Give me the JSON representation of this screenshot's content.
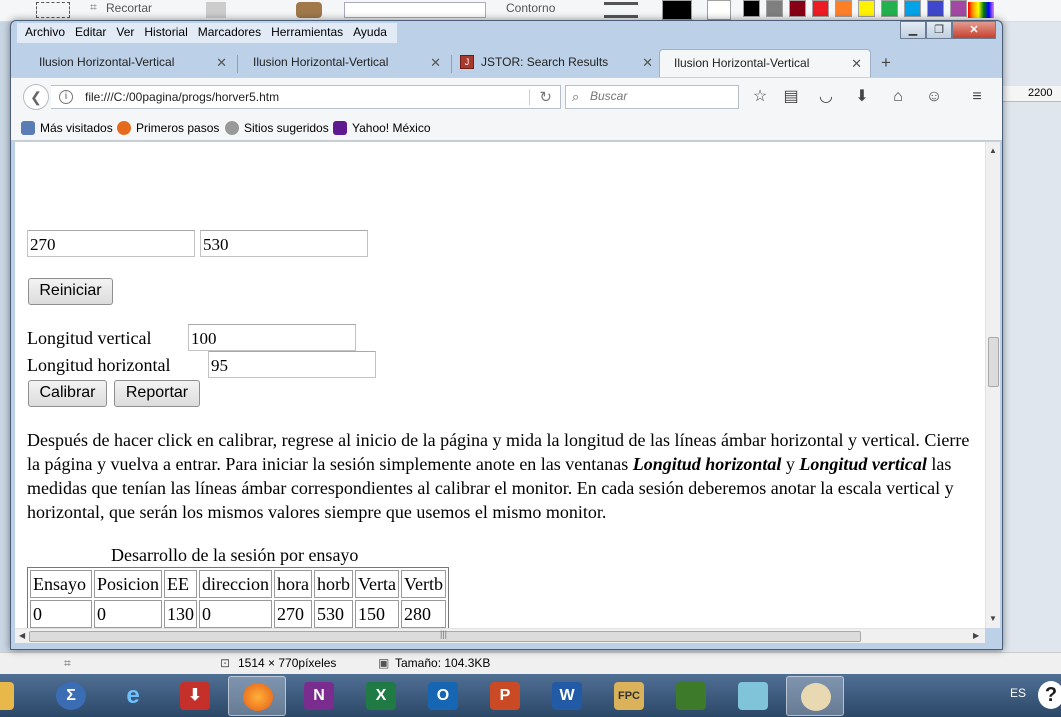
{
  "background_app": {
    "toolbar": {
      "crop_label": "Recortar",
      "outline_label": "Contorno"
    },
    "colors": [
      "#000000",
      "#7f7f7f",
      "#880015",
      "#ed1c24",
      "#ff7f27",
      "#fff200",
      "#22b14c",
      "#00a2e8",
      "#3f48cc",
      "#a349a4"
    ],
    "ruler_value": "2200",
    "status": {
      "dimensions": "1514 × 770píxeles",
      "size": "Tamaño: 104.3KB"
    }
  },
  "browser": {
    "menu": [
      "Archivo",
      "Editar",
      "Ver",
      "Historial",
      "Marcadores",
      "Herramientas",
      "Ayuda"
    ],
    "tabs": [
      {
        "title": "Ilusion Horizontal-Vertical"
      },
      {
        "title": "Ilusion Horizontal-Vertical"
      },
      {
        "title": "JSTOR: Search Results"
      },
      {
        "title": "Ilusion Horizontal-Vertical",
        "selected": true
      }
    ],
    "url": "file:///C:/00pagina/progs/horver5.htm",
    "search_placeholder": "Buscar",
    "bookmarks": [
      "Más visitados",
      "Primeros pasos",
      "Sitios sugeridos",
      "Yahoo! México"
    ]
  },
  "page": {
    "coord_x": "270",
    "coord_y": "530",
    "reset_label": "Reiniciar",
    "vertical_label": "Longitud vertical",
    "vertical_value": "100",
    "horizontal_label": "Longitud horizontal",
    "horizontal_value": "95",
    "calibrate_label": "Calibrar",
    "report_label": "Reportar",
    "instructions": {
      "p1": "Después de hacer click en calibrar, regrese al inicio de la página y mida la longitud de las líneas ámbar horizontal y vertical. Cierre la página y vuelva a entrar. Para iniciar la sesión simplemente anote en las ventanas ",
      "b1": "Longitud horizontal",
      "p2": " y ",
      "b2": "Longitud vertical",
      "p3": " las medidas que tenían las líneas ámbar correspondientes al calibrar el monitor. En cada sesión deberemos anotar la escala vertical y horizontal, que serán los mismos valores siempre que usemos el mismo monitor."
    },
    "table_caption": "Desarrollo de la sesión por ensayo",
    "table_headers": [
      "Ensayo",
      "Posicion",
      "EE",
      "direccion",
      "hora",
      "horb",
      "Verta",
      "Vertb"
    ],
    "table_rows": [
      [
        "0",
        "0",
        "130",
        "0",
        "270",
        "530",
        "150",
        "280"
      ]
    ]
  },
  "taskbar": {
    "language": "ES"
  }
}
